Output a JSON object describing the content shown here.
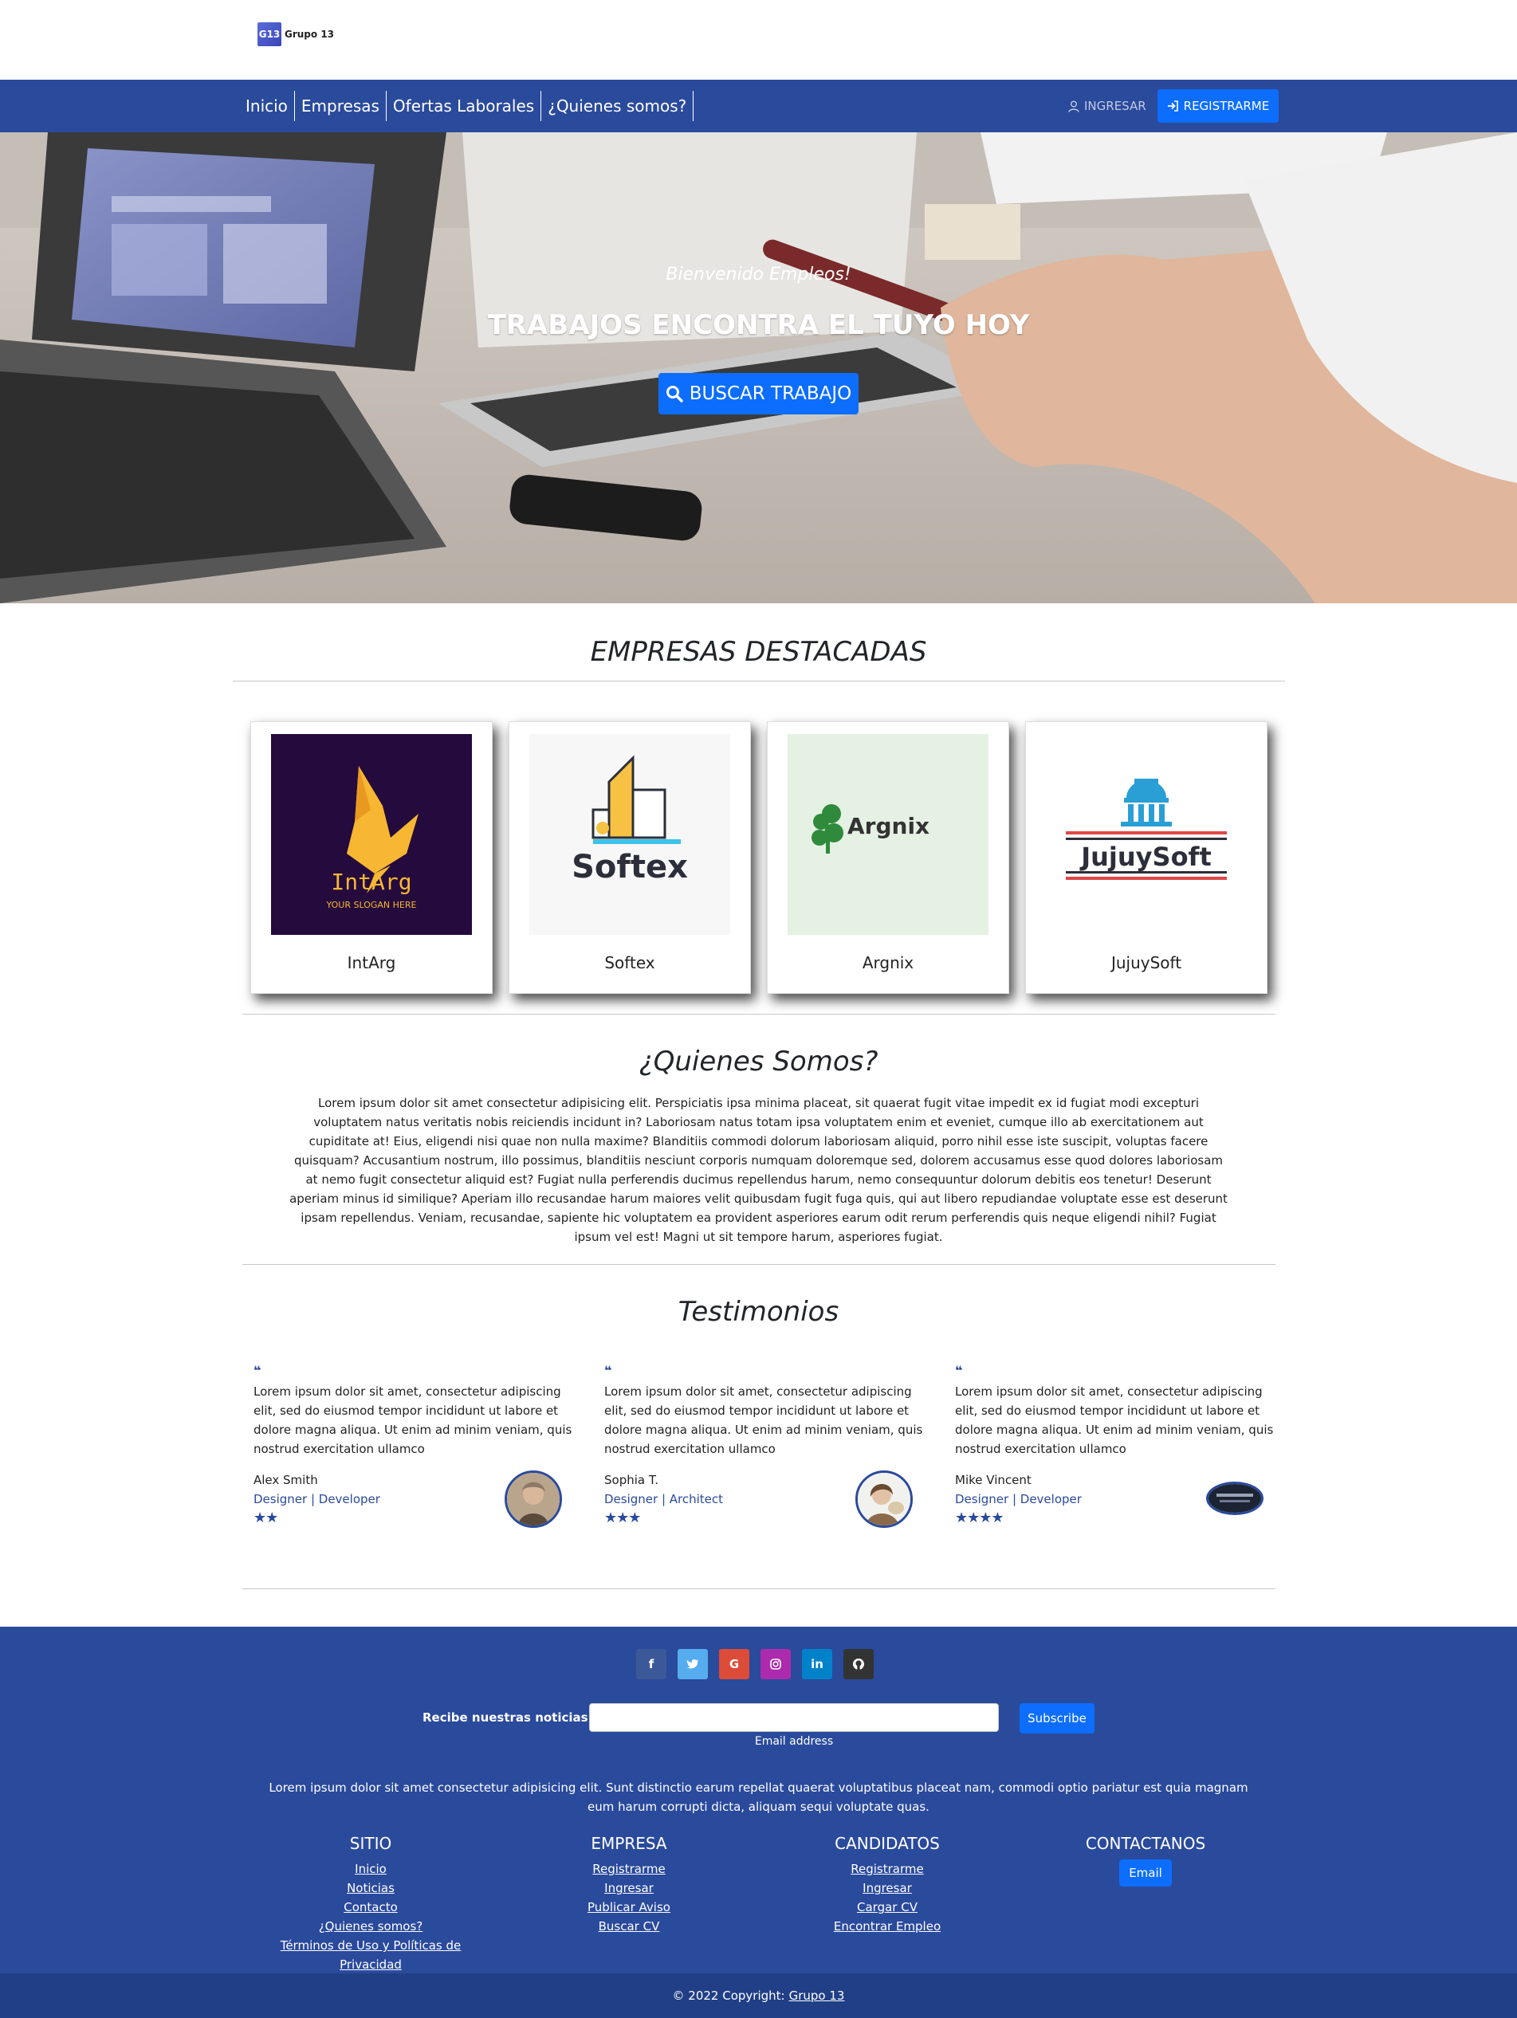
{
  "brand": {
    "mark": "G13",
    "name": "Grupo 13"
  },
  "nav": {
    "links": [
      "Inicio",
      "Empresas",
      "Ofertas Laborales",
      "¿Quienes somos?"
    ],
    "login_label": "INGRESAR",
    "register_label": "REGISTRARME"
  },
  "hero": {
    "subtitle": "Bienvenido Empleos!",
    "title": "TRABAJOS ENCONTRA EL TUYO HOY",
    "button_label": "BUSCAR TRABAJO"
  },
  "companies": {
    "title": "EMPRESAS DESTACADAS",
    "items": [
      {
        "name": "IntArg",
        "logo_text": "IntArg",
        "logo_slogan": "YOUR SLOGAN HERE"
      },
      {
        "name": "Softex",
        "logo_text": "Softex"
      },
      {
        "name": "Argnix",
        "logo_text": "Argnix"
      },
      {
        "name": "JujuySoft",
        "logo_text": "JujuySoft"
      }
    ]
  },
  "about": {
    "title": "¿Quienes Somos?",
    "text": "Lorem ipsum dolor sit amet consectetur adipisicing elit. Perspiciatis ipsa minima placeat, sit quaerat fugit vitae impedit ex id fugiat modi excepturi voluptatem natus veritatis nobis reiciendis incidunt in? Laboriosam natus totam ipsa voluptatem enim et eveniet, cumque illo ab exercitationem aut cupiditate at! Eius, eligendi nisi quae non nulla maxime? Blanditiis commodi dolorum laboriosam aliquid, porro nihil esse iste suscipit, voluptas facere quisquam? Accusantium nostrum, illo possimus, blanditiis nesciunt corporis numquam doloremque sed, dolorem accusamus esse quod dolores laboriosam at nemo fugit consectetur aliquid est? Fugiat nulla perferendis ducimus repellendus harum, nemo consequuntur dolorum debitis eos tenetur! Deserunt aperiam minus id similique? Aperiam illo recusandae harum maiores velit quibusdam fugit fuga quis, qui aut libero repudiandae voluptate esse est deserunt ipsam repellendus. Veniam, recusandae, sapiente hic voluptatem ea provident asperiores earum odit rerum perferendis quis neque eligendi nihil? Fugiat ipsum vel est! Magni ut sit tempore harum, asperiores fugiat."
  },
  "testimonials": {
    "title": "Testimonios",
    "items": [
      {
        "quote": "Lorem ipsum dolor sit amet, consectetur adipiscing elit, sed do eiusmod tempor incididunt ut labore et dolore magna aliqua. Ut enim ad minim veniam, quis nostrud exercitation ullamco",
        "name": "Alex Smith",
        "role": "Designer | Developer",
        "rating": 2,
        "stars": "★★"
      },
      {
        "quote": "Lorem ipsum dolor sit amet, consectetur adipiscing elit, sed do eiusmod tempor incididunt ut labore et dolore magna aliqua. Ut enim ad minim veniam, quis nostrud exercitation ullamco",
        "name": "Sophia T.",
        "role": "Designer | Architect",
        "rating": 3,
        "stars": "★★★"
      },
      {
        "quote": "Lorem ipsum dolor sit amet, consectetur adipiscing elit, sed do eiusmod tempor incididunt ut labore et dolore magna aliqua. Ut enim ad minim veniam, quis nostrud exercitation ullamco",
        "name": "Mike Vincent",
        "role": "Designer | Developer",
        "rating": 4,
        "stars": "★★★★"
      }
    ]
  },
  "footer": {
    "social": [
      {
        "icon": "facebook-icon",
        "glyph": "f",
        "color": "#3b5998"
      },
      {
        "icon": "twitter-icon",
        "glyph": "t",
        "color": "#55acee"
      },
      {
        "icon": "google-icon",
        "glyph": "G",
        "color": "#dd4b39"
      },
      {
        "icon": "instagram-icon",
        "glyph": "◎",
        "color": "#ac2bac"
      },
      {
        "icon": "linkedin-icon",
        "glyph": "in",
        "color": "#0082ca"
      },
      {
        "icon": "github-icon",
        "glyph": "●",
        "color": "#333333"
      }
    ],
    "newsletter_label": "Recibe nuestras noticias!",
    "email_hint": "Email address",
    "subscribe_label": "Subscribe",
    "text": "Lorem ipsum dolor sit amet consectetur adipisicing elit. Sunt distinctio earum repellat quaerat voluptatibus placeat nam, commodi optio pariatur est quia magnam eum harum corrupti dicta, aliquam sequi voluptate quas.",
    "columns": [
      {
        "title": "SITIO",
        "links": [
          "Inicio",
          "Noticias",
          "Contacto",
          "¿Quienes somos?",
          "Términos de Uso y Políticas de Privacidad"
        ]
      },
      {
        "title": "EMPRESA",
        "links": [
          "Registrarme",
          "Ingresar",
          "Publicar Aviso",
          "Buscar CV"
        ]
      },
      {
        "title": "CANDIDATOS",
        "links": [
          "Registrarme",
          "Ingresar",
          "Cargar CV",
          "Encontrar Empleo"
        ]
      },
      {
        "title": "CONTACTANOS",
        "button": "Email"
      }
    ],
    "copyright_text": "© 2022 Copyright:",
    "copyright_link": "Grupo 13"
  },
  "colors": {
    "primary": "#2a4a9c",
    "accent": "#0d6efd",
    "copyright_bg": "#213f86"
  }
}
